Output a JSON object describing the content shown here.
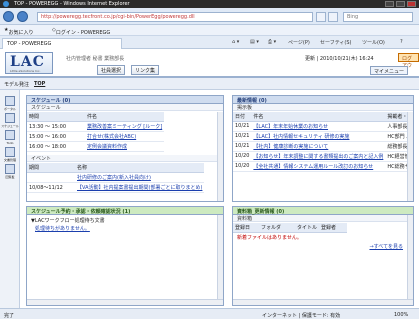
{
  "window": {
    "title": "TOP - POWEREGG - Windows Internet Explorer"
  },
  "address": {
    "url": "http://poweregg.tecfront.co.jp/cgi-bin/PowerEgg/poweregg.dll",
    "search_placeholder": "Bing"
  },
  "favorites": {
    "label": "お気に入り",
    "item": "ログイン - POWEREGG"
  },
  "tab": {
    "label": "TOP - POWEREGG"
  },
  "commands": {
    "page": "ページ(P)",
    "safety": "セーフティ(S)",
    "tools": "ツール(O)"
  },
  "app": {
    "logo": "LAC",
    "logo_sub": "Little eSolutions Inc.",
    "user": "社内管理者  秘書  業務部長",
    "btn_user_select": "社員選択",
    "btn_links": "リンク集",
    "date": "更新 | 2010/10/21(木) 16:24",
    "btn_logout": "ログアウト",
    "btn_mymenu": "マイメニュー"
  },
  "menubar": {
    "item1": "モデル発注",
    "item2": "TOP"
  },
  "leftnav": [
    {
      "label": "ポータル"
    },
    {
      "label": "スケジュール"
    },
    {
      "label": "Todo"
    },
    {
      "label": "文書管理"
    },
    {
      "label": "回覧板"
    }
  ],
  "schedule": {
    "title": "スケジュール (0)",
    "sub": "スケジュール",
    "col_time": "時間",
    "col_subject": "件名",
    "rows": [
      {
        "time": "13:30 ～ 15:00",
        "subject": "業務改善案ミーティング [ルーク]"
      },
      {
        "time": "15:00 ～ 16:00",
        "subject": "打合せ(株式会社ABC)"
      },
      {
        "time": "16:00 ～ 18:00",
        "subject": "定例会議資料作成"
      }
    ],
    "event_label": "イベント",
    "col_period": "期間",
    "col_name": "名称",
    "events": [
      {
        "period": "",
        "name": "社内研修のご案内(新入社員向け)"
      },
      {
        "period": "10/08～11/12",
        "name": "【VA活動】社内提案書提出期間(部署ごとに取りまとめ)"
      }
    ]
  },
  "news": {
    "title": "最新情報 (0)",
    "sub": "掲示板",
    "col_date": "日付",
    "col_subject": "件名",
    "col_poster": "掲載者・部署",
    "rows": [
      {
        "date": "10/21",
        "subject": "【LAC】年末年始休業のお知らせ",
        "poster": "人事部長"
      },
      {
        "date": "10/21",
        "subject": "【LAC】社内情報セキュリティ 研修の実施",
        "poster": "HC部門 人事本部長"
      },
      {
        "date": "10/21",
        "subject": "【社内】健康診断の実施について",
        "poster": "総務部長"
      },
      {
        "date": "10/20",
        "subject": "【お知らせ】年末調整に関する書類提出のご案内と記入例",
        "poster": "HC経営管理室 経理部長"
      },
      {
        "date": "10/20",
        "subject": "【全社共通】情報システム運用ルール改訂のお知らせ",
        "poster": "HC総務サービス部長"
      }
    ]
  },
  "reservation": {
    "title": "スケジュール予約・承認・依頼確認状況 (1)",
    "row1": "▼LACワークフロー処理待ち文書",
    "row2": "処理待ちがありません。"
  },
  "docs": {
    "title": "資料箱_更新情報 (0)",
    "sub": "資料箱",
    "col_date": "登録日",
    "col_folder": "フォルダ",
    "col_title": "タイトル",
    "col_registrant": "登録者",
    "empty": "新着ファイルはありません。",
    "all_link": "→すべてを見る"
  },
  "status": {
    "left": "完了",
    "zone": "インターネット | 保護モード: 有効",
    "zoom": "100%"
  }
}
